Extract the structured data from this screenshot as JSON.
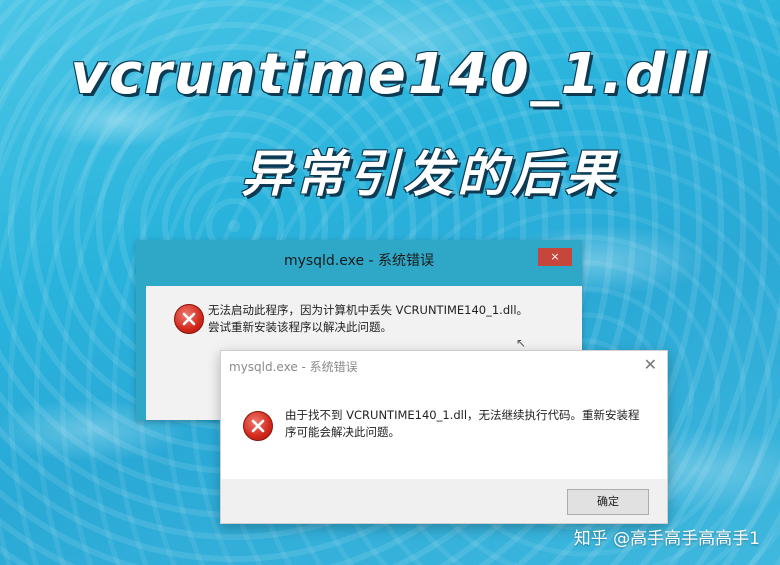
{
  "headline": {
    "line1": "vcruntime140_1.dll",
    "line2": "异常引发的后果"
  },
  "back_dialog": {
    "title": "mysqld.exe - 系统错误",
    "close_label": "×",
    "message": "无法启动此程序，因为计算机中丢失 VCRUNTIME140_1.dll。尝试重新安装该程序以解决此问题。",
    "icon": "error-icon"
  },
  "front_dialog": {
    "title": "mysqld.exe - 系统错误",
    "close_label": "✕",
    "message": "由于找不到 VCRUNTIME140_1.dll，无法继续执行代码。重新安装程序可能会解决此问题。",
    "icon": "error-icon",
    "ok_label": "确定"
  },
  "watermark": "知乎 @高手高手高高手1",
  "colors": {
    "back_titlebar": "#2fa8c7",
    "close_red": "#c7463c",
    "error_red": "#d2281c",
    "water": "#29b3dc"
  }
}
